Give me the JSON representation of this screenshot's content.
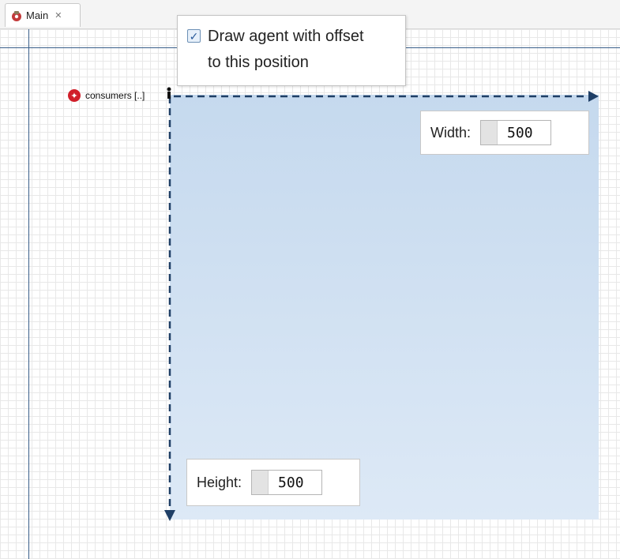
{
  "tab": {
    "label": "Main",
    "close_glyph": "✕",
    "icon": "agent-model-icon"
  },
  "popup": {
    "checkbox_checked": true,
    "checkbox_glyph": "✓",
    "label_line1": "Draw agent with offset",
    "label_line2": "to this position"
  },
  "agent": {
    "icon": "agent-population-icon",
    "icon_glyph": "✦",
    "label": "consumers [..]"
  },
  "width_box": {
    "label": "Width:",
    "value": "500"
  },
  "height_box": {
    "label": "Height:",
    "value": "500"
  },
  "colors": {
    "axis": "#3a5f8a",
    "arrow": "#1f3f66",
    "area_top": "#c5d9ee",
    "area_bottom": "#dde9f6",
    "agent_icon": "#d11f2a"
  }
}
